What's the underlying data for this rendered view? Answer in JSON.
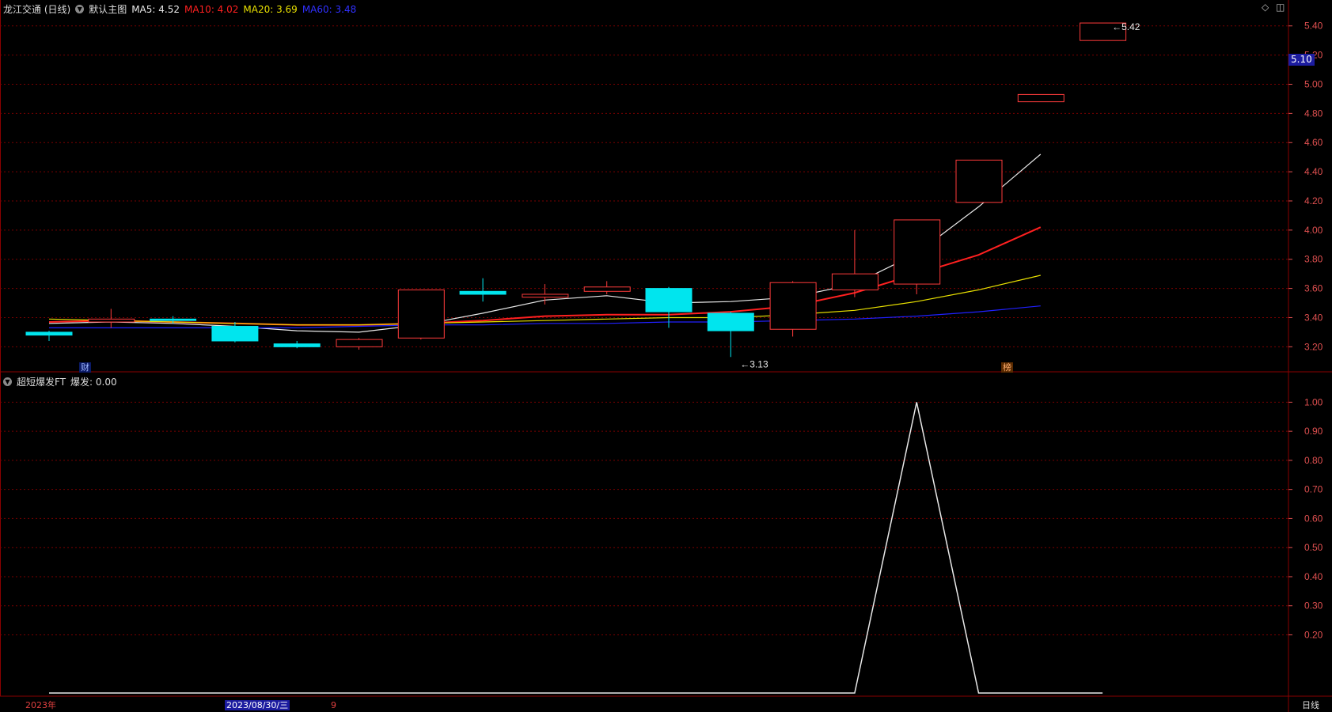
{
  "upper_header": {
    "stock": "龙江交通 (日线)",
    "template_label": "默认主图",
    "ma5": "MA5: 4.52",
    "ma10": "MA10: 4.02",
    "ma20": "MA20: 3.69",
    "ma60": "MA60: 3.48"
  },
  "lower_header": {
    "indicator": "超短爆发FT",
    "value_label": "爆发: 0.00"
  },
  "current_price_tag": "5.10",
  "badges": {
    "cai": "财",
    "bang": "榜"
  },
  "bottom_bar": {
    "year": "2023年",
    "cursor_date": "2023/08/30/三",
    "month": "9",
    "period": "日线"
  },
  "colors": {
    "up": "#ff3b3b",
    "down": "#00e5ee",
    "ma5": "#e8e8e8",
    "ma10": "#ff2020",
    "ma20": "#e8e000",
    "ma60": "#2020ff",
    "grid": "#7a0000",
    "axis_text": "#e05050"
  },
  "chart_data": [
    {
      "type": "candlestick",
      "ylim": [
        3.05,
        5.48
      ],
      "yticks": [
        "3.20",
        "3.40",
        "3.60",
        "3.80",
        "4.00",
        "4.20",
        "4.40",
        "4.60",
        "4.80",
        "5.00",
        "5.20",
        "5.40"
      ],
      "candles": [
        {
          "o": 3.3,
          "h": 3.31,
          "l": 3.24,
          "c": 3.28
        },
        {
          "o": 3.37,
          "h": 3.46,
          "l": 3.33,
          "c": 3.39
        },
        {
          "o": 3.39,
          "h": 3.41,
          "l": 3.36,
          "c": 3.38
        },
        {
          "o": 3.34,
          "h": 3.37,
          "l": 3.23,
          "c": 3.24
        },
        {
          "o": 3.22,
          "h": 3.24,
          "l": 3.19,
          "c": 3.2
        },
        {
          "o": 3.2,
          "h": 3.26,
          "l": 3.18,
          "c": 3.25
        },
        {
          "o": 3.26,
          "h": 3.59,
          "l": 3.25,
          "c": 3.59
        },
        {
          "o": 3.58,
          "h": 3.67,
          "l": 3.51,
          "c": 3.56
        },
        {
          "o": 3.54,
          "h": 3.63,
          "l": 3.49,
          "c": 3.56
        },
        {
          "o": 3.58,
          "h": 3.65,
          "l": 3.56,
          "c": 3.61
        },
        {
          "o": 3.6,
          "h": 3.61,
          "l": 3.33,
          "c": 3.44
        },
        {
          "o": 3.43,
          "h": 3.44,
          "l": 3.13,
          "c": 3.31
        },
        {
          "o": 3.32,
          "h": 3.65,
          "l": 3.27,
          "c": 3.64
        },
        {
          "o": 3.59,
          "h": 4.0,
          "l": 3.54,
          "c": 3.7
        },
        {
          "o": 3.63,
          "h": 4.07,
          "l": 3.56,
          "c": 4.07
        },
        {
          "o": 4.19,
          "h": 4.48,
          "l": 4.19,
          "c": 4.48
        },
        {
          "o": 4.88,
          "h": 4.93,
          "l": 4.88,
          "c": 4.93
        },
        {
          "o": 5.3,
          "h": 5.42,
          "l": 5.3,
          "c": 5.42
        }
      ],
      "ma_series": [
        {
          "name": "MA5",
          "values": [
            3.36,
            3.37,
            3.36,
            3.34,
            3.31,
            3.3,
            3.35,
            3.43,
            3.52,
            3.55,
            3.5,
            3.51,
            3.54,
            3.63,
            3.84,
            4.16,
            4.52
          ]
        },
        {
          "name": "MA10",
          "values": [
            3.37,
            3.38,
            3.37,
            3.36,
            3.35,
            3.35,
            3.36,
            3.38,
            3.41,
            3.42,
            3.42,
            3.44,
            3.48,
            3.57,
            3.7,
            3.83,
            4.02
          ]
        },
        {
          "name": "MA20",
          "values": [
            3.39,
            3.38,
            3.37,
            3.36,
            3.35,
            3.35,
            3.36,
            3.37,
            3.38,
            3.39,
            3.4,
            3.4,
            3.42,
            3.45,
            3.51,
            3.59,
            3.69
          ]
        },
        {
          "name": "MA60",
          "values": [
            3.33,
            3.33,
            3.33,
            3.33,
            3.33,
            3.34,
            3.35,
            3.35,
            3.36,
            3.36,
            3.37,
            3.37,
            3.38,
            3.39,
            3.41,
            3.44,
            3.48
          ]
        }
      ],
      "annotations": [
        {
          "text": "5.42",
          "candle": 17,
          "value": 5.42
        },
        {
          "text": "3.13",
          "candle": 11,
          "value": 3.13
        }
      ]
    },
    {
      "type": "line",
      "ylim": [
        0.0,
        1.05
      ],
      "yticks": [
        "0.20",
        "0.30",
        "0.40",
        "0.50",
        "0.60",
        "0.70",
        "0.80",
        "0.90",
        "1.00"
      ],
      "series": [
        {
          "name": "爆发",
          "values": [
            0,
            0,
            0,
            0,
            0,
            0,
            0,
            0,
            0,
            0,
            0,
            0,
            0,
            0,
            1.0,
            0,
            0,
            0
          ]
        }
      ]
    }
  ]
}
